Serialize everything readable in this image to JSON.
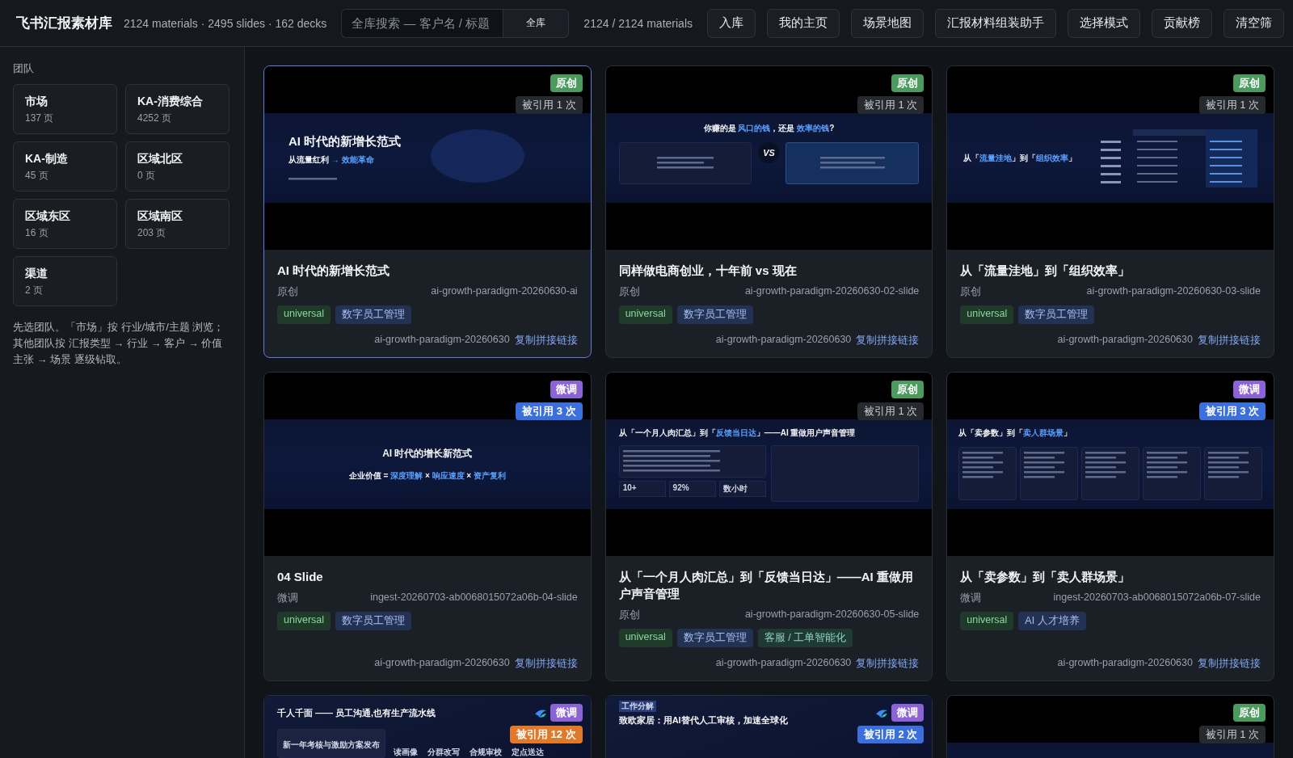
{
  "header": {
    "title": "飞书汇报素材库",
    "stats": "2124 materials · 2495 slides · 162 decks",
    "search": {
      "placeholder": "全库搜索 — 客户名 / 标题",
      "scope": "全库"
    },
    "count": "2124 / 2124 materials",
    "buttons": [
      "入库",
      "我的主页",
      "场景地图",
      "汇报材料组装助手",
      "选择模式",
      "贡献榜",
      "清空筛"
    ]
  },
  "sidebar": {
    "label": "团队",
    "teams": [
      {
        "name": "市场",
        "pages": "137 页"
      },
      {
        "name": "KA-消费综合",
        "pages": "4252 页"
      },
      {
        "name": "KA-制造",
        "pages": "45 页"
      },
      {
        "name": "区域北区",
        "pages": "0 页"
      },
      {
        "name": "区域东区",
        "pages": "16 页"
      },
      {
        "name": "区域南区",
        "pages": "203 页"
      },
      {
        "name": "渠道",
        "pages": "2 页"
      }
    ],
    "hint": "先选团队。「市场」按 行业/城市/主题 浏览；其他团队按 汇报类型 → 行业 → 客户 → 价值主张 → 场景 逐级钻取。"
  },
  "cards": [
    {
      "selected": true,
      "badge": {
        "label": "原创",
        "color": "#4b9a5e"
      },
      "cited": {
        "label": "被引用 1 次",
        "color": "#26292e"
      },
      "brand_mark": false,
      "preview": {
        "kind": "title",
        "heading": [
          {
            "text": "AI 时代的新增长范式"
          }
        ],
        "sub": [
          {
            "text": "从流量红利 "
          },
          {
            "text": "→ 效能革命",
            "accent": true
          }
        ]
      },
      "title": "AI 时代的新增长范式",
      "origin": "原创",
      "slide_id": "ai-growth-paradigm-20260630-ai",
      "tags": [
        {
          "label": "universal",
          "kind": "scope"
        },
        {
          "label": "数字员工管理",
          "kind": "topic"
        }
      ],
      "deck": "ai-growth-paradigm-20260630",
      "link": "复制拼接链接"
    },
    {
      "selected": false,
      "badge": {
        "label": "原创",
        "color": "#4b9a5e"
      },
      "cited": {
        "label": "被引用 1 次",
        "color": "#26292e"
      },
      "brand_mark": false,
      "preview": {
        "kind": "compare",
        "heading": [
          {
            "text": "你赚的是 "
          },
          {
            "text": "风口的钱",
            "accent": true
          },
          {
            "text": "，还是 "
          },
          {
            "text": "效率的钱",
            "accent": true
          },
          {
            "text": "?"
          }
        ],
        "mark": "VS"
      },
      "title": "同样做电商创业，十年前 vs 现在",
      "origin": "原创",
      "slide_id": "ai-growth-paradigm-20260630-02-slide",
      "tags": [
        {
          "label": "universal",
          "kind": "scope"
        },
        {
          "label": "数字员工管理",
          "kind": "topic"
        }
      ],
      "deck": "ai-growth-paradigm-20260630",
      "link": "复制拼接链接"
    },
    {
      "selected": false,
      "badge": {
        "label": "原创",
        "color": "#4b9a5e"
      },
      "cited": {
        "label": "被引用 1 次",
        "color": "#26292e"
      },
      "brand_mark": false,
      "preview": {
        "kind": "table",
        "heading": [
          {
            "text": "从「"
          },
          {
            "text": "流量洼地",
            "accent": true
          },
          {
            "text": "」到「"
          },
          {
            "text": "组织效率",
            "accent": true
          },
          {
            "text": "」"
          }
        ]
      },
      "title": "从「流量洼地」到「组织效率」",
      "origin": "原创",
      "slide_id": "ai-growth-paradigm-20260630-03-slide",
      "tags": [
        {
          "label": "universal",
          "kind": "scope"
        },
        {
          "label": "数字员工管理",
          "kind": "topic"
        }
      ],
      "deck": "ai-growth-paradigm-20260630",
      "link": "复制拼接链接"
    },
    {
      "selected": false,
      "badge": {
        "label": "微调",
        "color": "#8b63d6"
      },
      "cited": {
        "label": "被引用 3 次",
        "color": "#3b6fdc"
      },
      "brand_mark": false,
      "preview": {
        "kind": "formula",
        "heading": [
          {
            "text": "AI 时代的增长新范式"
          }
        ],
        "sub": [
          {
            "text": "企业价值 = "
          },
          {
            "text": "深度理解",
            "accent": true
          },
          {
            "text": " × "
          },
          {
            "text": "响应速度",
            "accent": true
          },
          {
            "text": " × "
          },
          {
            "text": "资产复利",
            "accent": true
          }
        ]
      },
      "title": "04 Slide",
      "origin": "微调",
      "slide_id": "ingest-20260703-ab0068015072a06b-04-slide",
      "tags": [
        {
          "label": "universal",
          "kind": "scope"
        },
        {
          "label": "数字员工管理",
          "kind": "topic"
        }
      ],
      "deck": "ai-growth-paradigm-20260630",
      "link": "复制拼接链接"
    },
    {
      "selected": false,
      "badge": {
        "label": "原创",
        "color": "#4b9a5e"
      },
      "cited": {
        "label": "被引用 1 次",
        "color": "#26292e"
      },
      "brand_mark": false,
      "preview": {
        "kind": "report",
        "heading": [
          {
            "text": "从「一个月人肉汇总」到「"
          },
          {
            "text": "反馈当日达",
            "accent": true
          },
          {
            "text": "」——AI 重做用户声音管理"
          }
        ],
        "stats": [
          "10+",
          "92%",
          "数小时"
        ]
      },
      "title": "从「一个月人肉汇总」到「反馈当日达」——AI 重做用户声音管理",
      "origin": "原创",
      "slide_id": "ai-growth-paradigm-20260630-05-slide",
      "tags": [
        {
          "label": "universal",
          "kind": "scope"
        },
        {
          "label": "数字员工管理",
          "kind": "topic"
        },
        {
          "label": "客服 / 工单智能化",
          "kind": "industry"
        }
      ],
      "deck": "ai-growth-paradigm-20260630",
      "link": "复制拼接链接"
    },
    {
      "selected": false,
      "badge": {
        "label": "微调",
        "color": "#8b63d6"
      },
      "cited": {
        "label": "被引用 3 次",
        "color": "#3b6fdc"
      },
      "brand_mark": false,
      "preview": {
        "kind": "columns",
        "heading": [
          {
            "text": "从「卖参数」到「"
          },
          {
            "text": "卖人群场景",
            "accent": true
          },
          {
            "text": "」"
          }
        ]
      },
      "title": "从「卖参数」到「卖人群场景」",
      "origin": "微调",
      "slide_id": "ingest-20260703-ab0068015072a06b-07-slide",
      "tags": [
        {
          "label": "universal",
          "kind": "scope"
        },
        {
          "label": "AI 人才培养",
          "kind": "topic"
        }
      ],
      "deck": "ai-growth-paradigm-20260630",
      "link": "复制拼接链接"
    },
    {
      "selected": false,
      "badge": {
        "label": "微调",
        "color": "#8b63d6"
      },
      "cited": {
        "label": "被引用 12 次",
        "color": "#e0792a"
      },
      "brand_mark": true,
      "preview": {
        "kind": "pipeline",
        "heading": [
          {
            "text": "千人千面 —— 员工沟通,也有生产流水线"
          }
        ],
        "note": "新一年考核与激励方案发布",
        "steps": [
          "读画像",
          "分群改写",
          "合规审校",
          "定点送达"
        ]
      }
    },
    {
      "selected": false,
      "badge": {
        "label": "微调",
        "color": "#8b63d6"
      },
      "cited": {
        "label": "被引用 2 次",
        "color": "#3b6fdc"
      },
      "brand_mark": true,
      "preview": {
        "kind": "news",
        "label": "工作分解",
        "heading": [
          {
            "text": "致欧家居：用AI替代人工审核，加速全球化"
          }
        ]
      }
    },
    {
      "selected": false,
      "badge": {
        "label": "原创",
        "color": "#4b9a5e"
      },
      "cited": {
        "label": "被引用 1 次",
        "color": "#26292e"
      },
      "brand_mark": false,
      "preview": {
        "kind": "blank"
      }
    }
  ]
}
